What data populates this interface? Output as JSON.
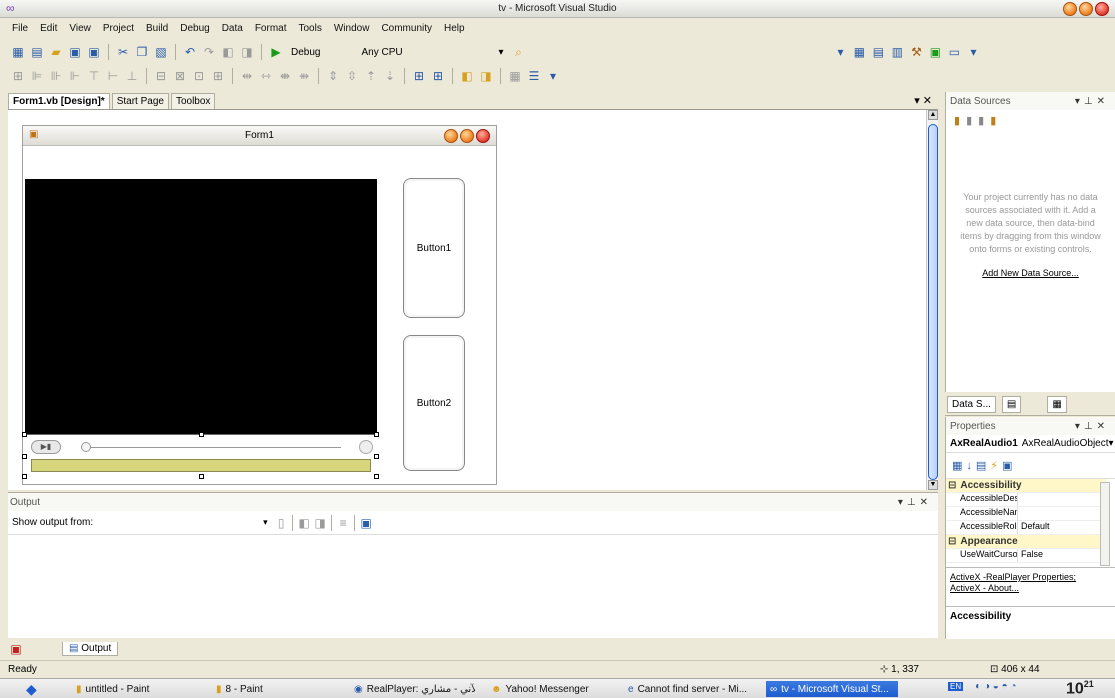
{
  "window": {
    "title": "tv - Microsoft Visual Studio"
  },
  "menu": [
    "File",
    "Edit",
    "View",
    "Project",
    "Build",
    "Debug",
    "Data",
    "Format",
    "Tools",
    "Window",
    "Community",
    "Help"
  ],
  "toolbar": {
    "config": "Debug",
    "platform": "Any CPU"
  },
  "doc_tabs": [
    "Form1.vb [Design]*",
    "Start Page",
    "Toolbox"
  ],
  "form": {
    "title": "Form1",
    "button1": "Button1",
    "button2": "Button2",
    "strip_color": "#d8d67c"
  },
  "data_sources": {
    "title": "Data Sources",
    "message": "Your project currently has no data sources associated with it. Add a new data source, then data-bind items by dragging from this window onto forms or existing controls.",
    "link": "Add New Data Source...",
    "tab": "Data S..."
  },
  "properties": {
    "title": "Properties",
    "object_name": "AxRealAudio1",
    "object_type": "AxRealAudioObject",
    "categories": [
      {
        "name": "Accessibility",
        "rows": [
          {
            "name": "AccessibleDesc",
            "value": ""
          },
          {
            "name": "AccessibleNam",
            "value": ""
          },
          {
            "name": "AccessibleRole",
            "value": "Default"
          }
        ]
      },
      {
        "name": "Appearance",
        "rows": [
          {
            "name": "UseWaitCursor",
            "value": "False"
          }
        ]
      }
    ],
    "link1": "ActiveX -RealPlayer Properties;",
    "link2": "ActiveX - About...",
    "description_title": "Accessibility"
  },
  "output": {
    "title": "Output",
    "show_from_label": "Show output from:",
    "tab": "Output"
  },
  "status": {
    "text": "Ready",
    "position": "1, 337",
    "size": "406 x 44"
  },
  "taskbar": {
    "tasks": [
      "untitled - Paint",
      "8 - Paint",
      "RealPlayer: الآني - مشاري...",
      "Yahoo! Messenger",
      "Cannot find server - Mi...",
      "tv - Microsoft Visual St..."
    ],
    "lang": "EN",
    "clock": "10",
    "clock_min": "21"
  }
}
